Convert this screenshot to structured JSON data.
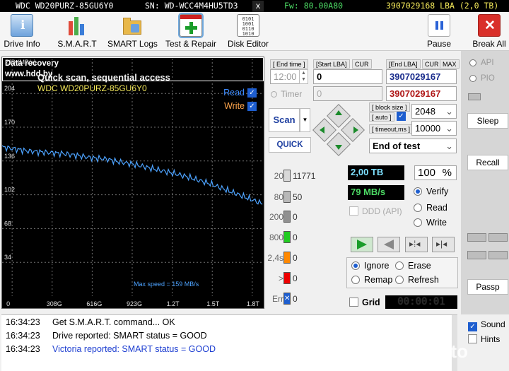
{
  "infobar": {
    "model": "WDC WD20PURZ-85GU6Y0",
    "sn": "SN: WD-WCC4M4HU5TD3",
    "close": "x",
    "fw": "Fw: 80.00A80",
    "lba": "3907029168 LBA (2,0 TB)"
  },
  "toolbar": [
    {
      "label": "Drive Info",
      "icon": "info-icon"
    },
    {
      "label": "S.M.A.R.T",
      "icon": "smart-bars-icon"
    },
    {
      "label": "SMART Logs",
      "icon": "folder-icon"
    },
    {
      "label": "Test & Repair",
      "icon": "plus-icon"
    },
    {
      "label": "Disk Editor",
      "icon": "binary-icon"
    }
  ],
  "toolbar_right": {
    "pause": "Pause",
    "break_all": "Break All"
  },
  "chart": {
    "unit": "239 (MB/s)",
    "title": "Quick scan, sequential access",
    "drive": "WDC WD20PURZ-85GU6Y0",
    "data_recovery_line1": "Data recovery",
    "data_recovery_line2": "www.hdd.by",
    "read_label": "Read",
    "write_label": "Write",
    "max_speed": "Max speed = 159 MB/s",
    "colors": {
      "read": "#4da3ff",
      "write": "#ffa64d",
      "grid": "#707070"
    }
  },
  "chart_data": {
    "type": "line",
    "title": "Quick scan, sequential access",
    "ylabel": "(MB/s)",
    "ylim": [
      0,
      239
    ],
    "yticks": [
      239,
      204,
      170,
      136,
      102,
      68,
      34
    ],
    "xticks": [
      "0",
      "308G",
      "616G",
      "923G",
      "1.2T",
      "1.5T",
      "1.8T"
    ],
    "xlim_gb": [
      0,
      2000
    ],
    "series": [
      {
        "name": "Read",
        "x": [
          0,
          100,
          200,
          300,
          400,
          500,
          600,
          700,
          800,
          900,
          1000,
          1100,
          1200,
          1300,
          1400,
          1500,
          1600,
          1700,
          1800,
          1900,
          2000
        ],
        "y": [
          150,
          148,
          146,
          145,
          144,
          143,
          141,
          139,
          138,
          135,
          133,
          130,
          127,
          124,
          121,
          117,
          113,
          108,
          103,
          98,
          93
        ]
      }
    ]
  },
  "center": {
    "end_time_label": "[ End time ]",
    "end_time_value": "12:00",
    "timer_label": "Timer",
    "start_lba_label": "[Start LBA]",
    "cur_label": "CUR",
    "start_lba_value": "0",
    "timer_value": "0",
    "end_lba_label": "[End LBA]",
    "end_lba_cur": "CUR",
    "end_lba_max": "MAX",
    "end_lba_value": "3907029167",
    "end_lba_current": "3907029167",
    "scan_button": "Scan",
    "quick_button": "QUICK",
    "block_size_label": "[ block size ]",
    "auto_label": "[ auto ]",
    "block_size_value": "2048",
    "timeout_label": "[ timeout,ms ]",
    "timeout_value": "10000",
    "end_of_test": "End of test"
  },
  "stats": [
    {
      "label": "20",
      "count": "11771",
      "color": "#d8d8d8"
    },
    {
      "label": "80",
      "count": "50",
      "color": "#b8b8b8"
    },
    {
      "label": "200",
      "count": "0",
      "color": "#909090"
    },
    {
      "label": "800",
      "count": "0",
      "color": "#22cc22"
    },
    {
      "label": "2,4s",
      "count": "0",
      "color": "#ff8800"
    },
    {
      "label": ">",
      "count": "0",
      "color": "#ee0000"
    },
    {
      "label": "Err",
      "count": "0",
      "color": "#1e5ecf"
    }
  ],
  "progress": {
    "size": "2,00 TB",
    "percent": "100",
    "percent_sign": "%",
    "speed": "79 MB/s",
    "ddd": "DDD (API)"
  },
  "mode": {
    "verify": "Verify",
    "read": "Read",
    "write": "Write"
  },
  "action": {
    "ignore": "Ignore",
    "erase": "Erase",
    "remap": "Remap",
    "refresh": "Refresh",
    "grid": "Grid",
    "elapsed": "00:00:01"
  },
  "sidebar": {
    "api": "API",
    "pio": "PIO",
    "sleep": "Sleep",
    "recall": "Recall",
    "passp": "Passp"
  },
  "log": [
    {
      "time": "16:34:23",
      "text": "Get S.M.A.R.T. command... OK",
      "color": "#000000"
    },
    {
      "time": "16:34:23",
      "text": "Drive reported: SMART status = GOOD",
      "color": "#000000"
    },
    {
      "time": "16:34:23",
      "text": "Victoria reported: SMART status = GOOD",
      "color": "#1e3fd1"
    }
  ],
  "bottom_right": {
    "sound": "Sound",
    "hints": "Hints"
  },
  "watermark": "Avito"
}
